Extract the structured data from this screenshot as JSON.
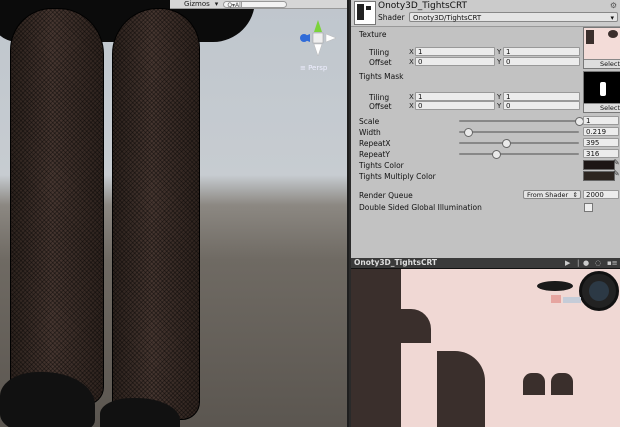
{
  "scene": {
    "gizmos_label": "Gizmos",
    "search_placeholder": "Q▾All",
    "persp_label": "≡ Persp"
  },
  "inspector": {
    "material_name": "Onoty3D_TightsCRT",
    "shader_label": "Shader",
    "shader_value": "Onoty3D/TightsCRT",
    "texture_section": "Texture",
    "mask_section": "Tights Mask",
    "tiling_label": "Tiling",
    "offset_label": "Offset",
    "x_label": "X",
    "y_label": "Y",
    "select_label": "Select",
    "texture": {
      "tiling_x": "1",
      "tiling_y": "1",
      "offset_x": "0",
      "offset_y": "0"
    },
    "mask": {
      "tiling_x": "1",
      "tiling_y": "1",
      "offset_x": "0",
      "offset_y": "0"
    },
    "sliders": [
      {
        "label": "Scale",
        "value": "1",
        "fraction": 1.0
      },
      {
        "label": "Width",
        "value": "0.219",
        "fraction": 0.073
      },
      {
        "label": "RepeatX",
        "value": "395",
        "fraction": 0.39
      },
      {
        "label": "RepeatY",
        "value": "316",
        "fraction": 0.31
      }
    ],
    "tights_color_label": "Tights Color",
    "tights_color": "#1c1615",
    "tights_multiply_label": "Tights Multiply Color",
    "tights_multiply_color": "#2d2520",
    "render_queue_label": "Render Queue",
    "render_queue_mode": "From Shader",
    "render_queue_value": "2000",
    "double_sided_label": "Double Sided Global Illumination"
  },
  "preview": {
    "title": "Onoty3D_TightsCRT"
  },
  "colors": {
    "inspector_bg": "#c2c2c2",
    "skin": "#f0d8d4",
    "tights": "#3a2f2c"
  }
}
